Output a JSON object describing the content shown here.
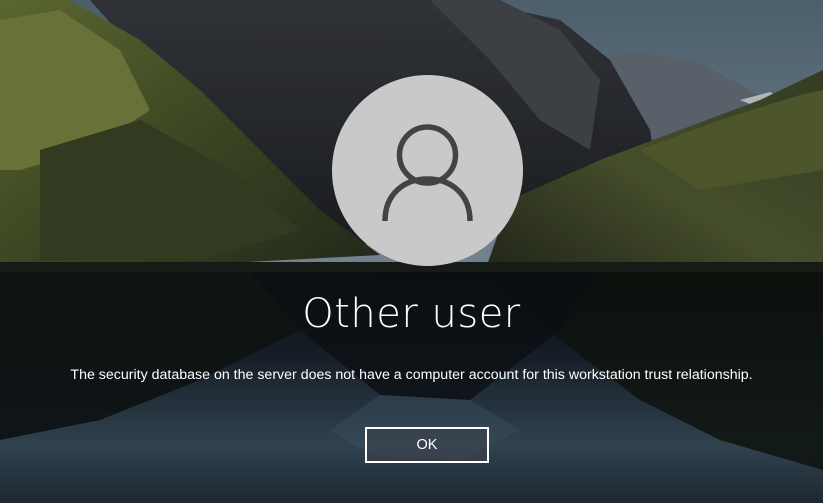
{
  "user": {
    "name": "Other user",
    "avatar_icon": "user-silhouette-icon"
  },
  "error": {
    "message": "The security database on the server does not have a computer account for this workstation trust relationship."
  },
  "actions": {
    "ok_label": "OK"
  },
  "colors": {
    "text": "#ffffff",
    "avatar_background": "#c9c9c9",
    "avatar_glyph": "#434343"
  }
}
